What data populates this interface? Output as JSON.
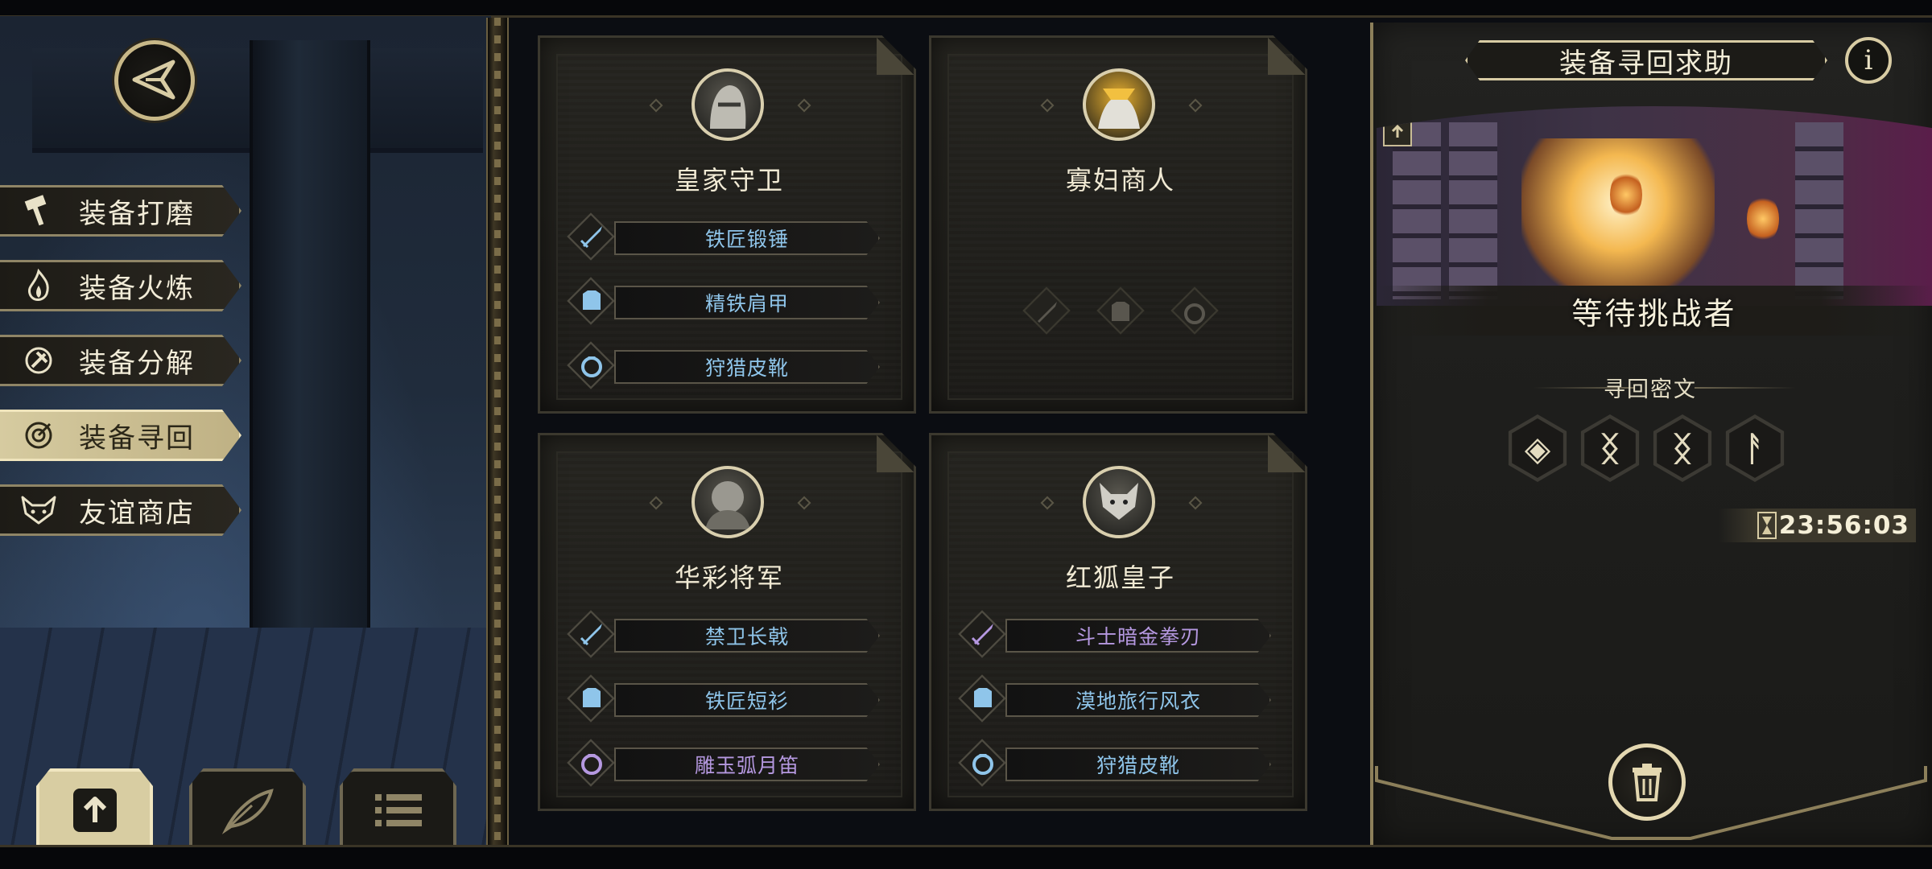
{
  "side_menu": {
    "items": [
      {
        "label": "装备打磨",
        "icon": "hammer-icon",
        "active": false
      },
      {
        "label": "装备火炼",
        "icon": "flame-icon",
        "active": false
      },
      {
        "label": "装备分解",
        "icon": "disassemble-icon",
        "active": false
      },
      {
        "label": "装备寻回",
        "icon": "target-icon",
        "active": true
      },
      {
        "label": "友谊商店",
        "icon": "fox-icon",
        "active": false
      }
    ]
  },
  "bottom_tabs": [
    {
      "icon": "upload-file-icon",
      "active": true
    },
    {
      "icon": "feather-icon",
      "active": false
    },
    {
      "icon": "list-icon",
      "active": false
    }
  ],
  "cards": [
    {
      "name": "皇家守卫",
      "equipment": [
        {
          "type": "sword-icon",
          "label": "铁匠锻锤",
          "rarity": "blue"
        },
        {
          "type": "armor-icon",
          "label": "精铁肩甲",
          "rarity": "blue"
        },
        {
          "type": "ring-icon",
          "label": "狩猎皮靴",
          "rarity": "blue"
        }
      ]
    },
    {
      "name": "寡妇商人",
      "equipment": []
    },
    {
      "name": "华彩将军",
      "equipment": [
        {
          "type": "sword-icon",
          "label": "禁卫长戟",
          "rarity": "blue"
        },
        {
          "type": "armor-icon",
          "label": "铁匠短衫",
          "rarity": "blue"
        },
        {
          "type": "ring-icon",
          "label": "雕玉弧月笛",
          "rarity": "purple"
        }
      ]
    },
    {
      "name": "红狐皇子",
      "equipment": [
        {
          "type": "sword-icon",
          "label": "斗士暗金拳刃",
          "rarity": "purple"
        },
        {
          "type": "armor-icon",
          "label": "漠地旅行风衣",
          "rarity": "blue"
        },
        {
          "type": "ring-icon",
          "label": "狩猎皮靴",
          "rarity": "blue"
        }
      ]
    }
  ],
  "right_panel": {
    "title": "装备寻回求助",
    "info_icon": "i",
    "status": "等待挑战者",
    "cipher_title": "寻回密文",
    "runes": [
      "◈",
      "ᛝ",
      "ᛝ",
      "ᚨ"
    ],
    "timer": "23:56:03"
  },
  "colors": {
    "gold": "#d8cca4",
    "blue_text": "#8fc5ea",
    "purple_text": "#b598e0"
  }
}
